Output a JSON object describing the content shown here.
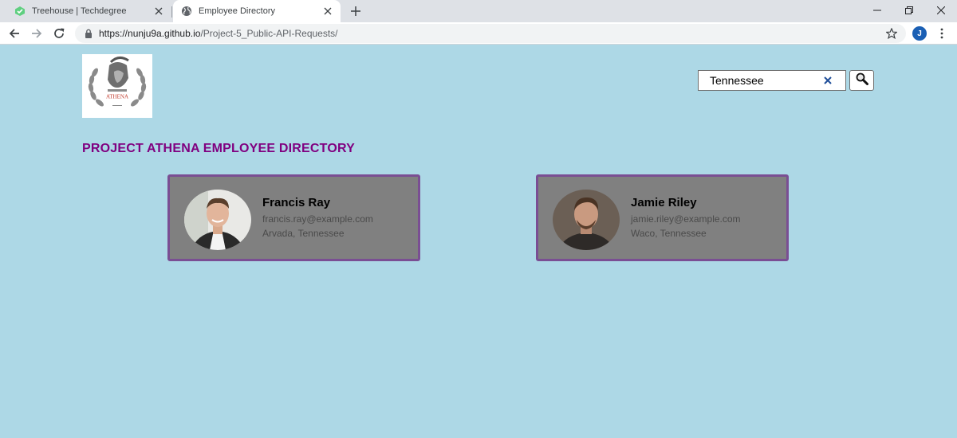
{
  "browser": {
    "tabs": [
      {
        "label": "Treehouse | Techdegree",
        "favicon": "treehouse-icon",
        "active": false
      },
      {
        "label": "Employee Directory",
        "favicon": "globe-icon",
        "active": true
      }
    ],
    "url_host": "https://nunju9a.github.io",
    "url_path": "/Project-5_Public-API-Requests/",
    "profile_initial": "J"
  },
  "header": {
    "logo_alt": "ATHENA"
  },
  "search": {
    "value": "Tennessee"
  },
  "main": {
    "title": "PROJECT ATHENA EMPLOYEE DIRECTORY",
    "employees": [
      {
        "name": "Francis Ray",
        "email": "francis.ray@example.com",
        "location": "Arvada, Tennessee"
      },
      {
        "name": "Jamie Riley",
        "email": "jamie.riley@example.com",
        "location": "Waco, Tennessee"
      }
    ]
  },
  "colors": {
    "page_background": "#add8e6",
    "title": "#800080",
    "card_background": "#808080",
    "card_border": "#7a4e93"
  }
}
